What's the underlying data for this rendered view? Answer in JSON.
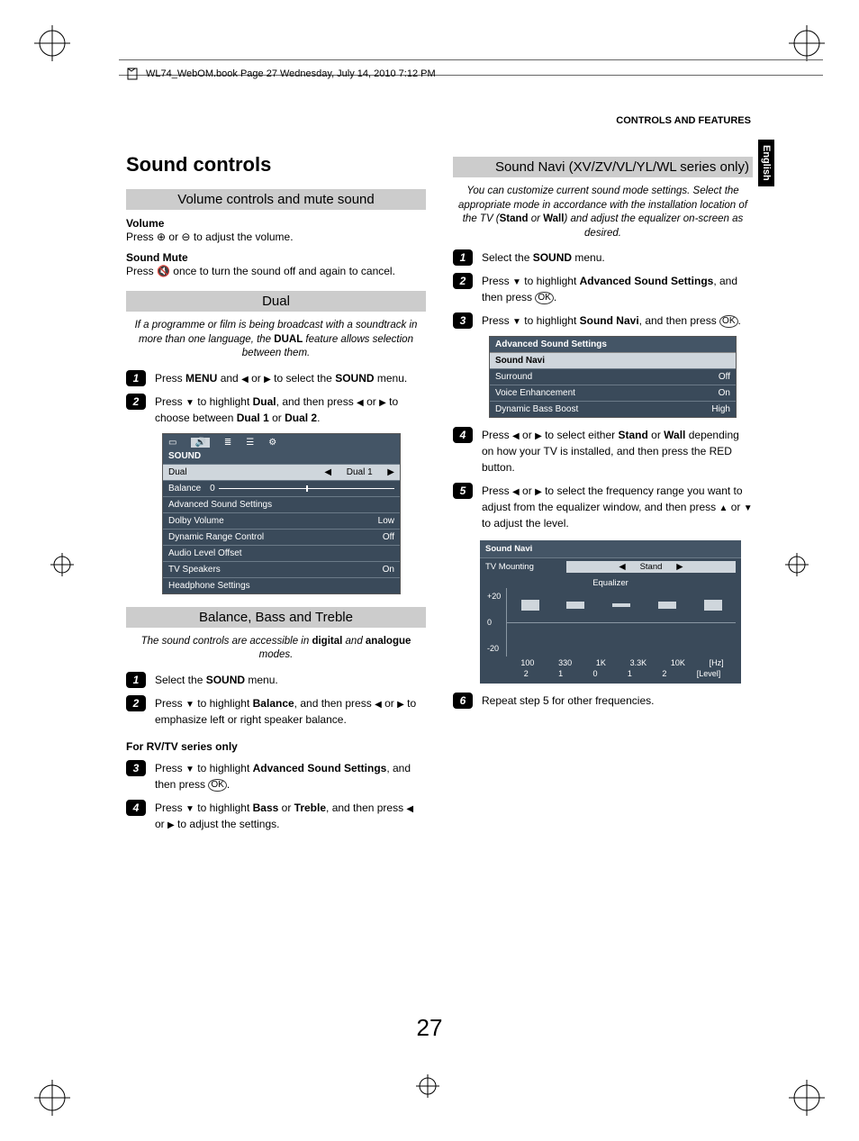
{
  "header": {
    "book_tag": "WL74_WebOM.book  Page 27  Wednesday, July 14, 2010  7:12 PM",
    "section": "CONTROLS AND FEATURES",
    "language_tab": "English"
  },
  "page_number": "27",
  "left_column": {
    "main_title": "Sound controls",
    "volume_section": {
      "header": "Volume controls and mute sound",
      "volume_label": "Volume",
      "volume_text_a": "Press ",
      "volume_text_b": " or ",
      "volume_text_c": " to adjust the volume.",
      "mute_label": "Sound Mute",
      "mute_text_a": "Press ",
      "mute_text_b": " once to turn the sound off and again to cancel."
    },
    "dual_section": {
      "header": "Dual",
      "intro": "If a programme or film is being broadcast with a soundtrack in more than one language, the DUAL feature allows selection between them.",
      "step1_a": "Press ",
      "step1_menu": "MENU",
      "step1_b": " and ",
      "step1_c": " or ",
      "step1_d": " to select the ",
      "step1_sound": "SOUND",
      "step1_e": " menu.",
      "step2_a": "Press ",
      "step2_b": " to highlight ",
      "step2_dual": "Dual",
      "step2_c": ", and then press ",
      "step2_d": " or ",
      "step2_e": " to choose between ",
      "step2_d1": "Dual 1",
      "step2_or": " or ",
      "step2_d2": "Dual 2",
      "step2_f": "."
    },
    "osd_sound": {
      "title": "SOUND",
      "rows": [
        {
          "label": "Dual",
          "value": "Dual 1",
          "hl": true
        },
        {
          "label": "Balance",
          "value": "0",
          "slider": true
        },
        {
          "label": "Advanced Sound Settings",
          "value": ""
        },
        {
          "label": "Dolby Volume",
          "value": "Low"
        },
        {
          "label": "Dynamic Range Control",
          "value": "Off"
        },
        {
          "label": "Audio Level Offset",
          "value": ""
        },
        {
          "label": "TV Speakers",
          "value": "On"
        },
        {
          "label": "Headphone Settings",
          "value": ""
        }
      ]
    },
    "balance_section": {
      "header": "Balance, Bass and Treble",
      "intro_a": "The sound controls are accessible in ",
      "intro_digital": "digital",
      "intro_b": " and ",
      "intro_analogue": "analogue",
      "intro_c": " modes.",
      "step1_a": "Select the ",
      "step1_sound": "SOUND",
      "step1_b": " menu.",
      "step2_a": "Press ",
      "step2_b": " to highlight ",
      "step2_balance": "Balance",
      "step2_c": ", and then press ",
      "step2_d": " or ",
      "step2_e": " to emphasize left or right speaker balance.",
      "rv_header": "For RV/TV series only",
      "step3_a": "Press ",
      "step3_b": " to highlight ",
      "step3_ass": "Advanced Sound Settings",
      "step3_c": ", and then press ",
      "step3_ok": "OK",
      "step3_d": ".",
      "step4_a": "Press ",
      "step4_b": " to highlight ",
      "step4_bass": "Bass",
      "step4_or": " or ",
      "step4_treble": "Treble",
      "step4_c": ", and then press ",
      "step4_d": " or ",
      "step4_e": " to adjust the settings."
    }
  },
  "right_column": {
    "navi_section": {
      "header": "Sound Navi (XV/ZV/VL/YL/WL series only)",
      "intro_a": "You can customize current sound mode settings. Select the appropriate mode in accordance with the installation location of the TV (",
      "intro_stand": "Stand",
      "intro_or": " or ",
      "intro_wall": "Wall",
      "intro_b": ") and adjust the equalizer on-screen as desired.",
      "step1_a": "Select the ",
      "step1_sound": "SOUND",
      "step1_b": " menu.",
      "step2_a": "Press ",
      "step2_b": " to highlight ",
      "step2_ass": "Advanced Sound Settings",
      "step2_c": ", and then press ",
      "step2_ok": "OK",
      "step2_d": ".",
      "step3_a": "Press ",
      "step3_b": " to highlight ",
      "step3_sn": "Sound Navi",
      "step3_c": ", and then press ",
      "step3_ok": "OK",
      "step3_d": "."
    },
    "osd_adv": {
      "title": "Advanced Sound Settings",
      "sub": "Sound Navi",
      "rows": [
        {
          "label": "Surround",
          "value": "Off"
        },
        {
          "label": "Voice Enhancement",
          "value": "On"
        },
        {
          "label": "Dynamic Bass Boost",
          "value": "High"
        }
      ]
    },
    "navi_steps_cont": {
      "step4_a": "Press ",
      "step4_b": " or ",
      "step4_c": " to select either ",
      "step4_stand": "Stand",
      "step4_or": " or ",
      "step4_wall": "Wall",
      "step4_d": " depending on how your TV is installed, and then press the RED button.",
      "step5_a": "Press ",
      "step5_b": " or ",
      "step5_c": " to select the frequency range you want to adjust from the equalizer window, and then press ",
      "step5_d": " or ",
      "step5_e": " to adjust the level.",
      "step6": "Repeat step 5 for other frequencies."
    },
    "eq": {
      "title": "Sound Navi",
      "mount_label": "TV Mounting",
      "mount_value": "Stand",
      "eq_label": "Equalizer",
      "y_plus": "+20",
      "y_zero": "0",
      "y_minus": "-20",
      "freqs": [
        "100",
        "330",
        "1K",
        "3.3K",
        "10K",
        "[Hz]"
      ],
      "levels": [
        "2",
        "1",
        "0",
        "1",
        "2",
        "[Level]"
      ]
    }
  },
  "chart_data": {
    "type": "bar",
    "title": "Equalizer",
    "xlabel": "[Hz]",
    "ylabel": "[Level]",
    "ylim": [
      -20,
      20
    ],
    "categories": [
      "100",
      "330",
      "1K",
      "3.3K",
      "10K"
    ],
    "values": [
      2,
      1,
      0,
      1,
      2
    ]
  }
}
